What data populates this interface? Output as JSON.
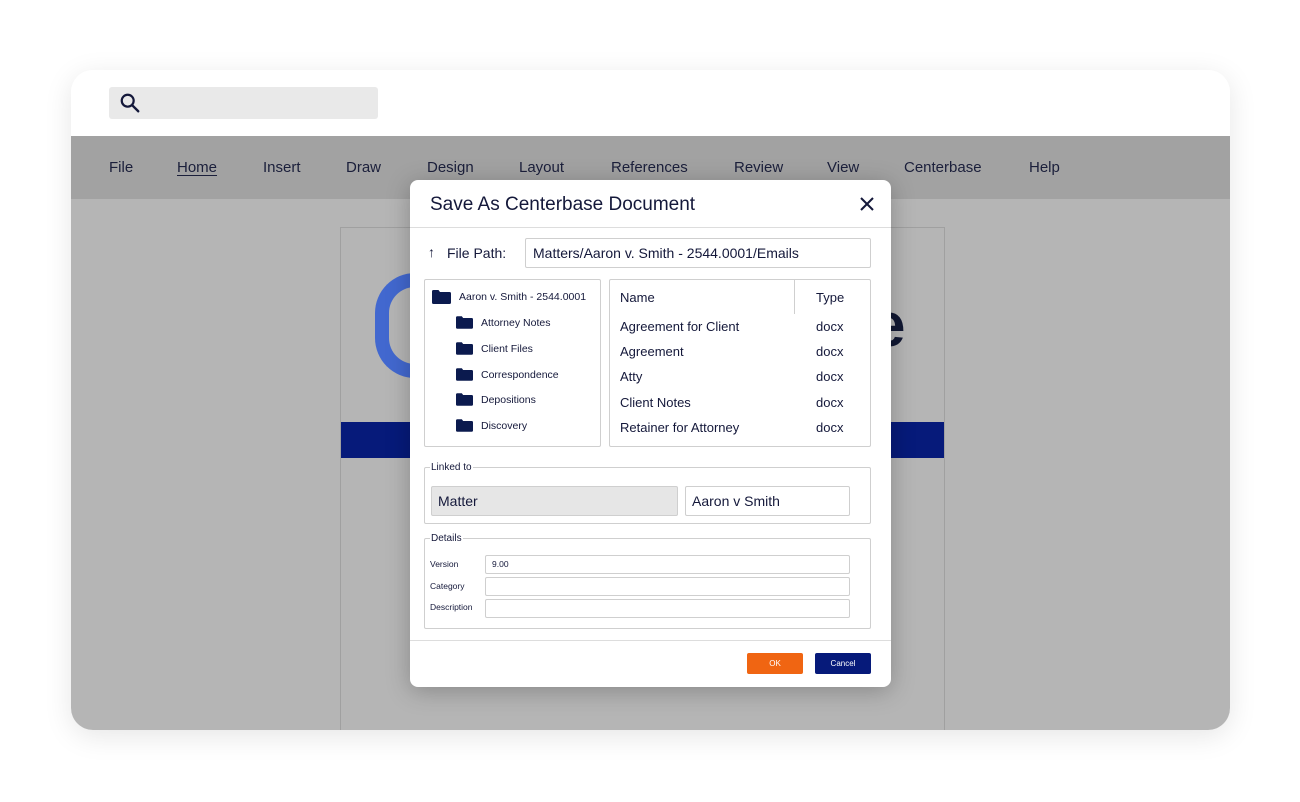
{
  "search": {
    "icon": "search-icon"
  },
  "ribbon": {
    "tabs": [
      {
        "label": "File"
      },
      {
        "label": "Home",
        "active": true
      },
      {
        "label": "Insert"
      },
      {
        "label": "Draw"
      },
      {
        "label": "Design"
      },
      {
        "label": "Layout"
      },
      {
        "label": "References"
      },
      {
        "label": "Review"
      },
      {
        "label": "View"
      },
      {
        "label": "Centerbase"
      },
      {
        "label": "Help"
      }
    ]
  },
  "document": {
    "logo_letter": "e",
    "band_color": "#061a7a"
  },
  "dialog": {
    "title": "Save As Centerbase Document",
    "close_icon": "close-icon",
    "file_path": {
      "label": "File Path:",
      "value": "Matters/Aaron v. Smith - 2544.0001/Emails",
      "up_icon": "↑"
    },
    "tree": {
      "root": "Aaron v. Smith - 2544.0001",
      "children": [
        "Attorney Notes",
        "Client Files",
        "Correspondence",
        "Depositions",
        "Discovery"
      ]
    },
    "files": {
      "columns": {
        "name": "Name",
        "type": "Type"
      },
      "rows": [
        {
          "name": "Agreement for Client",
          "type": "docx"
        },
        {
          "name": "Agreement",
          "type": "docx"
        },
        {
          "name": "Atty",
          "type": "docx"
        },
        {
          "name": "Client Notes",
          "type": "docx"
        },
        {
          "name": "Retainer for Attorney",
          "type": "docx"
        }
      ]
    },
    "linked": {
      "legend": "Linked to",
      "entity_type": "Matter",
      "entity_name": "Aaron v Smith"
    },
    "details": {
      "legend": "Details",
      "version_label": "Version",
      "version_value": "9.00",
      "category_label": "Category",
      "category_value": "",
      "description_label": "Description",
      "description_value": ""
    },
    "buttons": {
      "ok": "OK",
      "cancel": "Cancel"
    }
  },
  "colors": {
    "accent_orange": "#f06512",
    "accent_navy": "#061a7a",
    "text": "#14183a"
  }
}
